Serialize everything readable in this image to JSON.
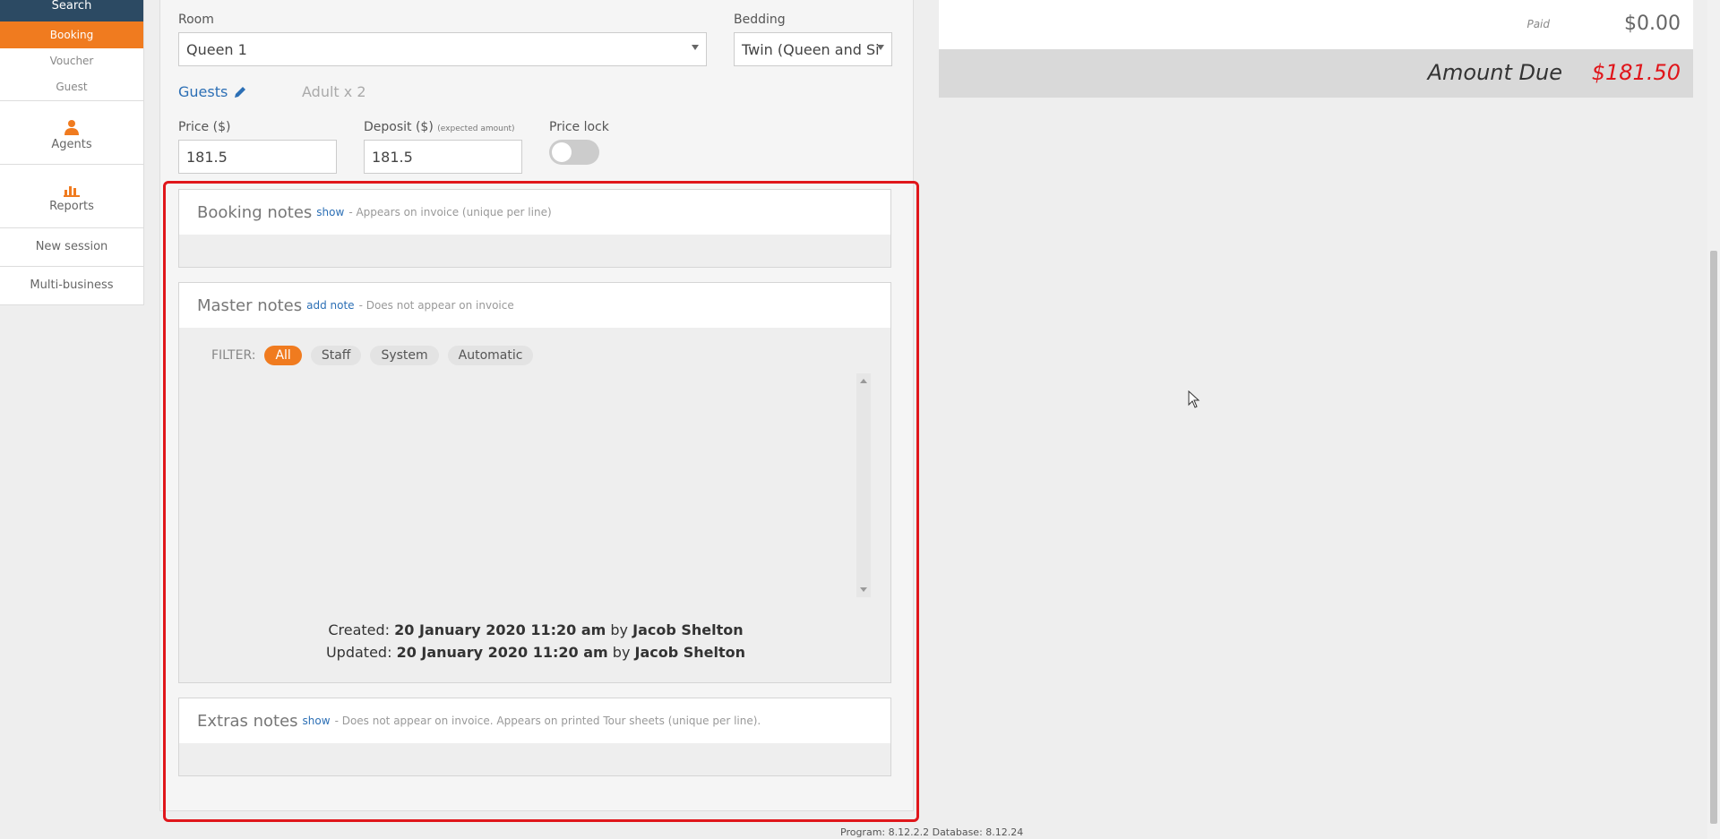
{
  "sidebar": {
    "search": "Search",
    "booking": "Booking",
    "voucher": "Voucher",
    "guest": "Guest",
    "agents": "Agents",
    "reports": "Reports",
    "new_session": "New session",
    "multi_business": "Multi-business"
  },
  "form": {
    "room_label": "Room",
    "room_value": "Queen 1",
    "bedding_label": "Bedding",
    "bedding_value": "Twin (Queen and Si",
    "guests_label": "Guests",
    "guests_value": "Adult x 2",
    "price_label": "Price ($)",
    "price_value": "181.5",
    "deposit_label": "Deposit ($)",
    "deposit_hint": "(expected amount)",
    "deposit_value": "181.5",
    "price_lock_label": "Price lock",
    "price_lock_on": false
  },
  "notes": {
    "booking": {
      "title": "Booking notes",
      "link": "show",
      "desc": "- Appears on invoice (unique per line)"
    },
    "master": {
      "title": "Master notes",
      "link": "add note",
      "desc": "- Does not appear on invoice",
      "filter_label": "FILTER:",
      "filters": [
        "All",
        "Staff",
        "System",
        "Automatic"
      ],
      "active_filter": "All",
      "created_label": "Created:",
      "created_date": "20 January 2020 11:20 am",
      "created_by_word": "by",
      "created_by": "Jacob Shelton",
      "updated_label": "Updated:",
      "updated_date": "20 January 2020 11:20 am",
      "updated_by_word": "by",
      "updated_by": "Jacob Shelton"
    },
    "extras": {
      "title": "Extras notes",
      "link": "show",
      "desc": "- Does not appear on invoice. Appears on printed Tour sheets (unique per line)."
    }
  },
  "summary": {
    "paid_label": "Paid",
    "paid_value": "$0.00",
    "due_label": "Amount Due",
    "due_value": "$181.50"
  },
  "footer": "Program: 8.12.2.2 Database: 8.12.24",
  "colors": {
    "accent": "#f07b1f",
    "nav_dark": "#2c4a63",
    "link": "#2c6fb5",
    "highlight": "#e0161b",
    "due": "#e0161b"
  }
}
